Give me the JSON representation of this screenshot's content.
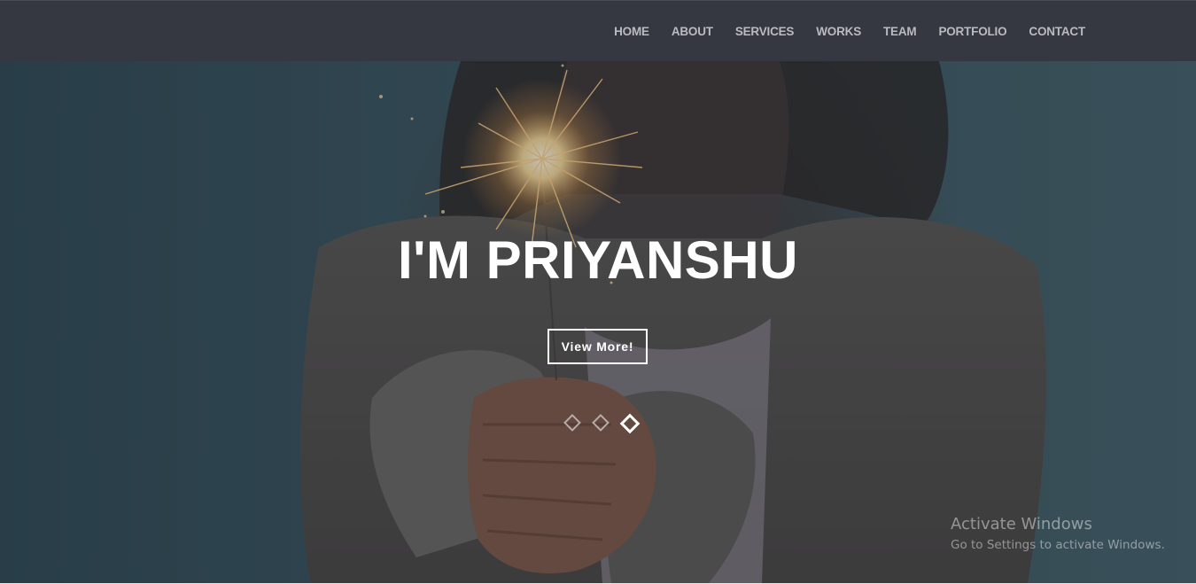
{
  "nav": {
    "items": [
      {
        "label": "HOME"
      },
      {
        "label": "ABOUT"
      },
      {
        "label": "SERVICES"
      },
      {
        "label": "WORKS"
      },
      {
        "label": "TEAM"
      },
      {
        "label": "PORTFOLIO"
      },
      {
        "label": "CONTACT"
      }
    ]
  },
  "hero": {
    "title": "I'M PRIYANSHU",
    "button_label": "View More!",
    "slides_total": 3,
    "active_slide": 3
  },
  "watermark": {
    "title": "Activate Windows",
    "subtitle": "Go to Settings to activate Windows."
  },
  "colors": {
    "navbar_bg": "#353840",
    "nav_text": "#b9bbbf",
    "hero_text": "#ffffff"
  }
}
